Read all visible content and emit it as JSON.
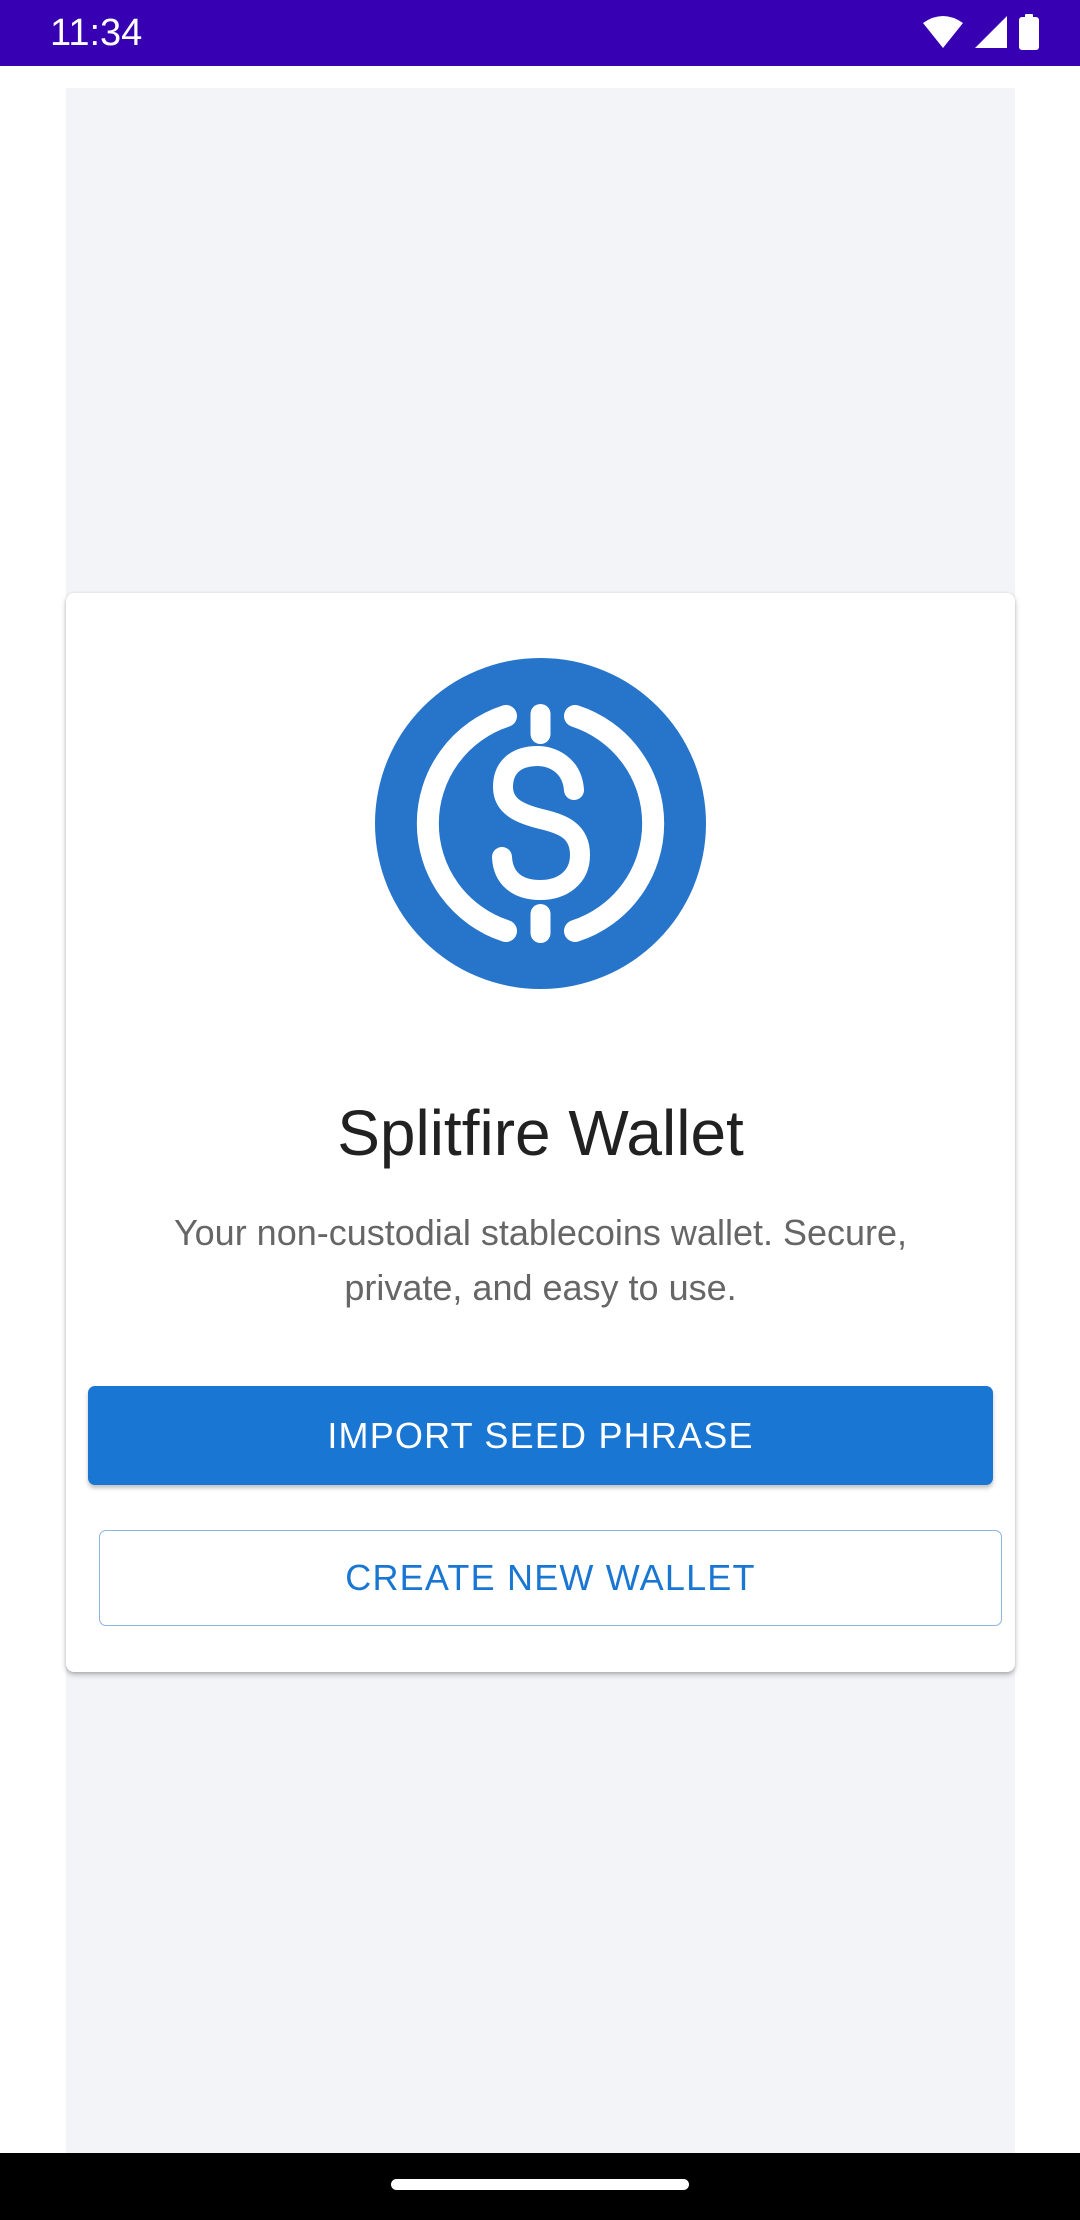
{
  "status_bar": {
    "time": "11:34",
    "icons": [
      "wifi-icon",
      "signal-icon",
      "battery-icon"
    ]
  },
  "welcome": {
    "logo_icon": "usdc-dollar-coin-icon",
    "title": "Splitfire Wallet",
    "tagline": "Your non-custodial stablecoins wallet. Secure, private, and easy to use.",
    "import_label": "IMPORT SEED PHRASE",
    "create_label": "CREATE NEW WALLET"
  },
  "colors": {
    "status_bar": "#3700b3",
    "primary": "#1976d2",
    "logo": "#2775ca",
    "page_background": "#f3f4f8"
  }
}
